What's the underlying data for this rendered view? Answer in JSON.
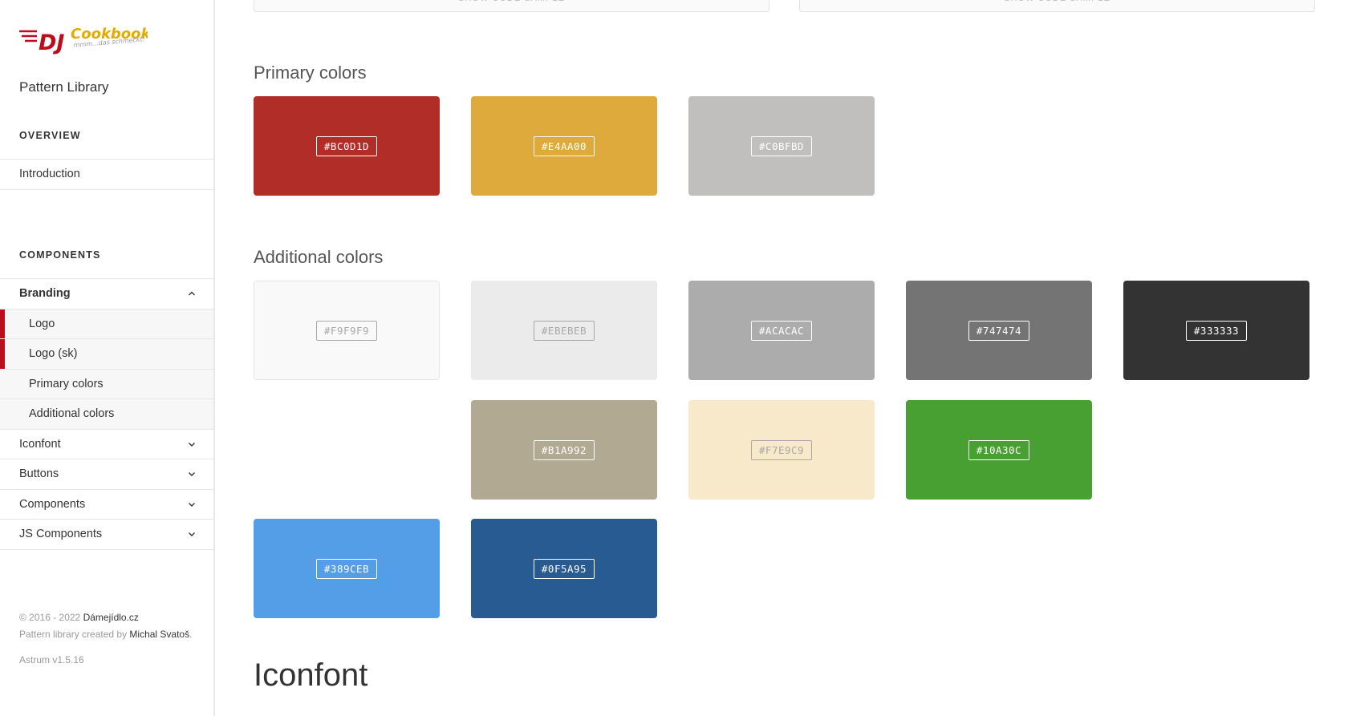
{
  "sidebar": {
    "logo": {
      "brand": "DJ",
      "name": "Cookbook",
      "tagline": "mmm...das schmeckt!"
    },
    "library_title": "Pattern Library",
    "overview": {
      "heading": "OVERVIEW",
      "items": [
        {
          "label": "Introduction"
        }
      ]
    },
    "components": {
      "heading": "COMPONENTS",
      "branding": {
        "label": "Branding",
        "sub": [
          {
            "label": "Logo"
          },
          {
            "label": "Logo (sk)"
          },
          {
            "label": "Primary colors"
          },
          {
            "label": "Additional colors"
          }
        ]
      },
      "items": [
        {
          "label": "Iconfont"
        },
        {
          "label": "Buttons"
        },
        {
          "label": "Components"
        },
        {
          "label": "JS Components"
        }
      ]
    },
    "footer": {
      "copyright": "© 2016 - 2022",
      "site": "Dámejídlo.cz",
      "created_by": "Pattern library created by",
      "author": "Michal Svatoš",
      "author_suffix": ".",
      "version": "Astrum v1.5.16"
    }
  },
  "main": {
    "code_buttons": [
      {
        "label": "SHOW CODE SAMPLE"
      },
      {
        "label": "SHOW CODE SAMPLE"
      }
    ],
    "primary": {
      "title": "Primary colors",
      "swatches": [
        {
          "code": "#BC0D1D",
          "color": "#b02d28"
        },
        {
          "code": "#E4AA00",
          "color": "#ddaa3b"
        },
        {
          "code": "#C0BFBD",
          "color": "#c0bfbd"
        }
      ]
    },
    "additional": {
      "title": "Additional colors",
      "swatches": [
        {
          "code": "#F9F9F9",
          "color": "#f9f9f9"
        },
        {
          "code": "#EBEBEB",
          "color": "#ebebeb"
        },
        {
          "code": "#ACACAC",
          "color": "#acacac"
        },
        {
          "code": "#747474",
          "color": "#747474"
        },
        {
          "code": "#333333",
          "color": "#333333"
        },
        {
          "code": "#B1A992",
          "color": "#b1a992"
        },
        {
          "code": "#F7E9C9",
          "color": "#f7e9c9"
        },
        {
          "code": "#10A30C",
          "color": "#47a031"
        },
        {
          "code": "#389CEB",
          "color": "#539ee6"
        },
        {
          "code": "#0F5A95",
          "color": "#285b91"
        }
      ]
    },
    "next_section_title": "Iconfont"
  },
  "colors": {
    "accent": "#bc0d1d",
    "logo_gold": "#e4aa00"
  }
}
